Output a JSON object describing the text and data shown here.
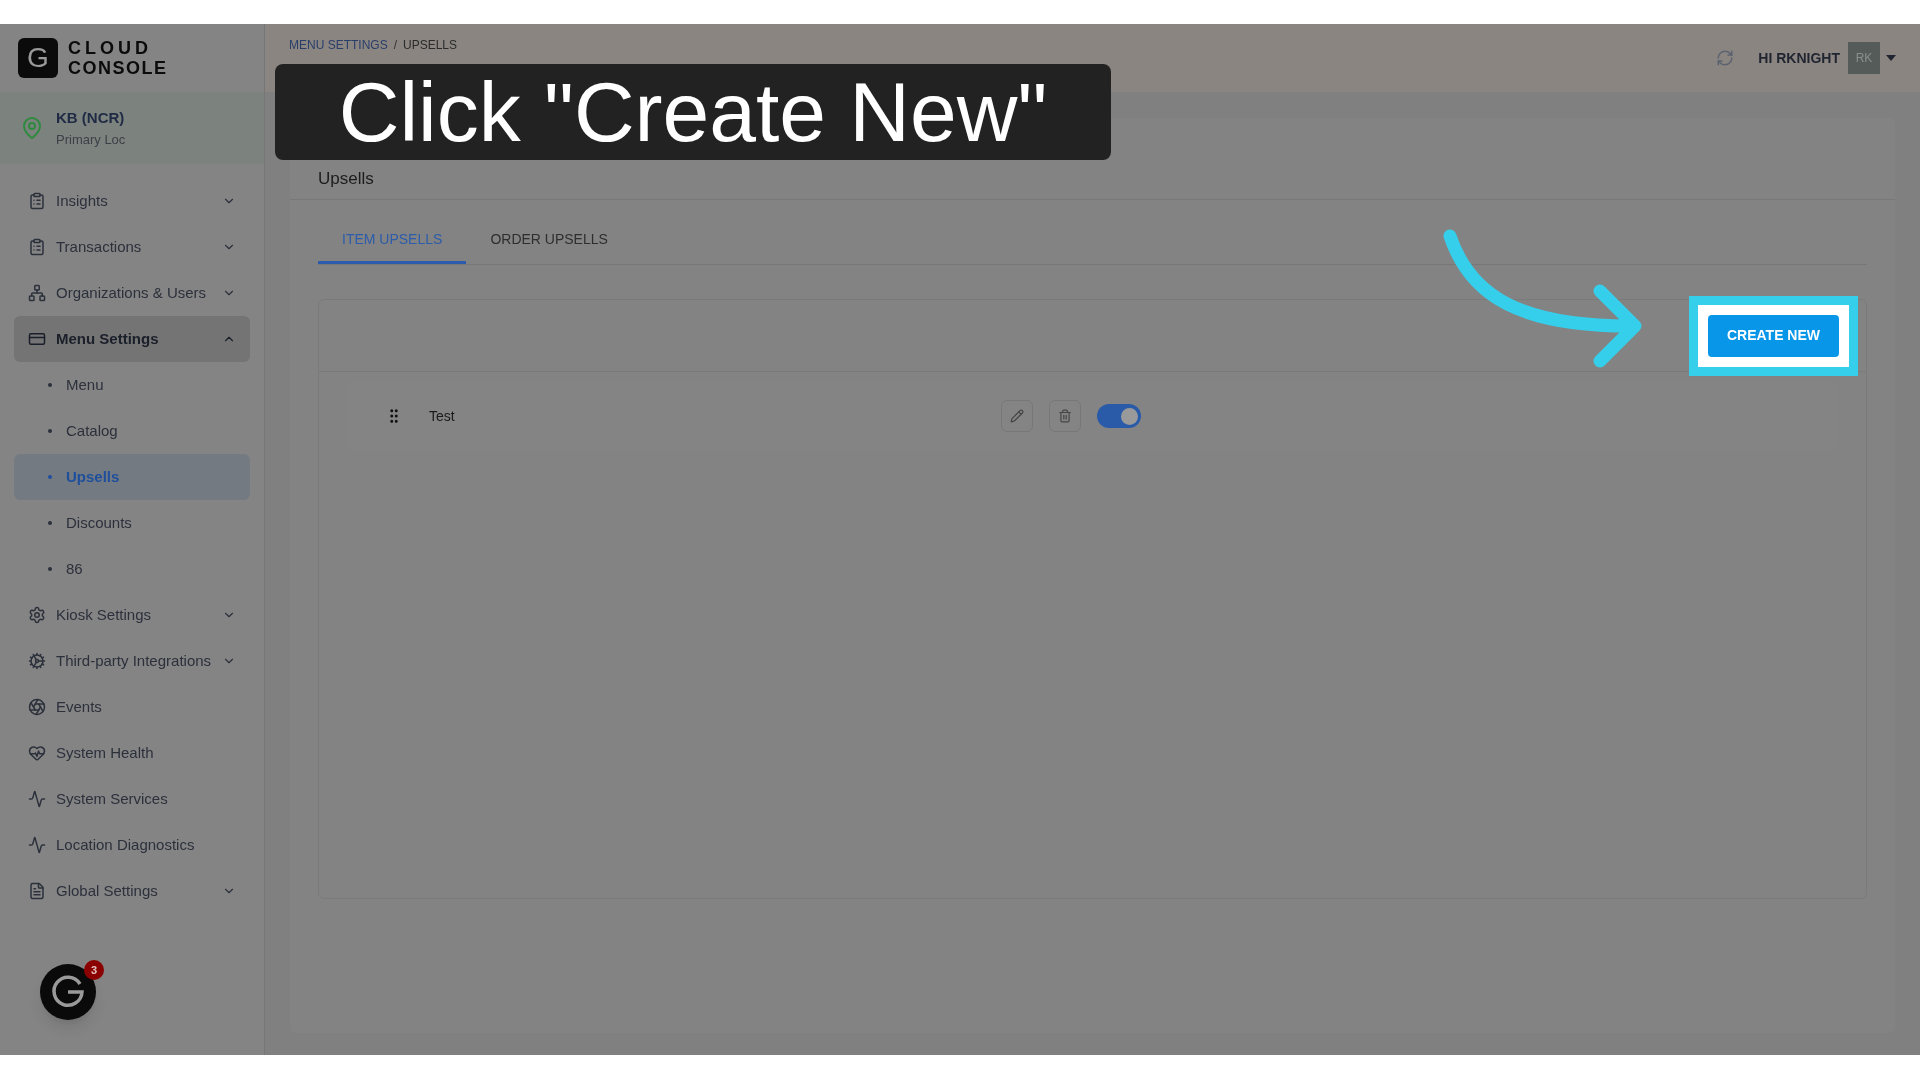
{
  "caption": "Click \"Create New\"",
  "logo": {
    "mark": "G",
    "line1": "CLOUD",
    "line2": "CONSOLE"
  },
  "location": {
    "name": "KB (NCR)",
    "subtitle": "Primary Loc"
  },
  "sidebar": {
    "items": [
      {
        "label": "Insights",
        "kind": "group",
        "expanded": false,
        "selected": false
      },
      {
        "label": "Transactions",
        "kind": "group",
        "expanded": false,
        "selected": false
      },
      {
        "label": "Organizations & Users",
        "kind": "group",
        "expanded": false,
        "selected": false
      },
      {
        "label": "Menu Settings",
        "kind": "group",
        "expanded": true,
        "selected": true,
        "children": [
          {
            "label": "Menu",
            "selected": false
          },
          {
            "label": "Catalog",
            "selected": false
          },
          {
            "label": "Upsells",
            "selected": true
          },
          {
            "label": "Discounts",
            "selected": false
          },
          {
            "label": "86",
            "selected": false
          }
        ]
      },
      {
        "label": "Kiosk Settings",
        "kind": "group",
        "expanded": false,
        "selected": false
      },
      {
        "label": "Third-party Integrations",
        "kind": "group",
        "expanded": false,
        "selected": false
      },
      {
        "label": "Events",
        "kind": "link",
        "selected": false
      },
      {
        "label": "System Health",
        "kind": "link",
        "selected": false
      },
      {
        "label": "System Services",
        "kind": "link",
        "selected": false
      },
      {
        "label": "Location Diagnostics",
        "kind": "link",
        "selected": false
      },
      {
        "label": "Global Settings",
        "kind": "group",
        "expanded": false,
        "selected": false
      }
    ]
  },
  "fab": {
    "badge": "3"
  },
  "header": {
    "breadcrumb": [
      "MENU SETTINGS",
      "UPSELLS"
    ],
    "breadcrumb_separator": "/",
    "greeting": "HI RKNIGHT",
    "avatar": "RK"
  },
  "page": {
    "title": "Upsells",
    "tabs": [
      {
        "label": "ITEM UPSELLS",
        "selected": true
      },
      {
        "label": "ORDER UPSELLS",
        "selected": false
      }
    ],
    "create_button": "CREATE NEW",
    "rows": [
      {
        "name": "Test",
        "enabled": true
      }
    ]
  }
}
